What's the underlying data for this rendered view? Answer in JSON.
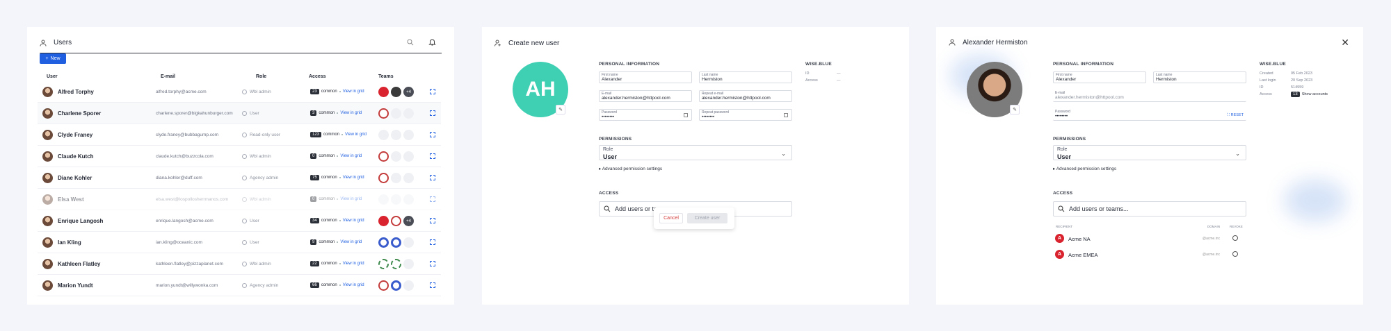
{
  "users_panel": {
    "title": "Users",
    "new_button": "New",
    "columns": [
      "User",
      "E-mail",
      "Role",
      "Access",
      "Teams"
    ],
    "common_label": "common",
    "view_label": "View in grid",
    "rows": [
      {
        "name": "Alfred Torphy",
        "email": "alfred.torphy@acme.com",
        "role": "Wbl admin",
        "count": "23",
        "teams": [
          "red",
          "dark",
          "plus"
        ],
        "plus": "+4"
      },
      {
        "name": "Charlene Sporer",
        "email": "charlene.sporer@bigkahunburger.com",
        "role": "User",
        "count": "3",
        "teams": [
          "logo",
          "empty",
          "empty"
        ]
      },
      {
        "name": "Clyde Franey",
        "email": "clyde.franey@bubbagump.com",
        "role": "Read-only user",
        "count": "123",
        "teams": [
          "empty",
          "empty",
          "empty"
        ]
      },
      {
        "name": "Claude Kutch",
        "email": "claude.kutch@buzzcola.com",
        "role": "Wbl admin",
        "count": "0",
        "teams": [
          "logo",
          "empty",
          "empty"
        ]
      },
      {
        "name": "Diane Kohler",
        "email": "diana.kohler@duff.com",
        "role": "Agency admin",
        "count": "75",
        "teams": [
          "logo",
          "empty",
          "empty"
        ]
      },
      {
        "name": "Elsa West",
        "email": "elsa.west@lospollosherrmanos.com",
        "role": "Wbl admin",
        "count": "0",
        "teams": [
          "empty",
          "empty",
          "empty"
        ],
        "dim": true
      },
      {
        "name": "Enrique Langosh",
        "email": "enrique.langosh@acme.com",
        "role": "User",
        "count": "34",
        "teams": [
          "red",
          "logo",
          "plus"
        ],
        "plus": "+4"
      },
      {
        "name": "Ian Kling",
        "email": "ian.kling@oceanic.com",
        "role": "User",
        "count": "9",
        "teams": [
          "blue",
          "blue",
          "empty"
        ]
      },
      {
        "name": "Kathleen Flatley",
        "email": "kathleen.flatley@pizzaplanet.com",
        "role": "Wbl admin",
        "count": "22",
        "teams": [
          "grn",
          "grn",
          "empty"
        ]
      },
      {
        "name": "Marion Yundt",
        "email": "marion.yundt@willywonka.com",
        "role": "Agency admin",
        "count": "66",
        "teams": [
          "logo",
          "blue",
          "empty"
        ]
      }
    ]
  },
  "create_panel": {
    "title": "Create new user",
    "initials": "AH",
    "personal_info": "PERSONAL INFORMATION",
    "first_name_label": "First name",
    "first_name": "Alexander",
    "last_name_label": "Last name",
    "last_name": "Hermiston",
    "email_label": "E-mail",
    "email": "alexander.hermiston@httpool.com",
    "repeat_email_label": "Repeat e-mail",
    "repeat_email": "alexander.hermiston@httpool.com",
    "password_label": "Password",
    "password": "••••••••",
    "repeat_password_label": "Repeat password",
    "repeat_password": "••••••••",
    "wise_title": "WISE.BLUE",
    "id_label": "ID",
    "id_value": "—",
    "access_label": "Access",
    "access_value": "—",
    "permissions": "PERMISSIONS",
    "role_label": "Role",
    "role_value": "User",
    "advanced": "Advanced permission settings",
    "access_title": "ACCESS",
    "search_placeholder": "Add users or teams...",
    "cancel": "Cancel",
    "create": "Create user"
  },
  "detail_panel": {
    "title": "Alexander Hermiston",
    "personal_info": "PERSONAL INFORMATION",
    "first_name_label": "First name",
    "first_name": "Alexander",
    "last_name_label": "Last name",
    "last_name": "Hermiston",
    "email_label": "E-mail",
    "email": "alexander.hermiston@httpool.com",
    "password_label": "Password",
    "password": "••••••••",
    "reset": "RESET",
    "wise_title": "WISE.BLUE",
    "created_label": "Created",
    "created": "05 Feb 2023",
    "last_login_label": "Last login",
    "last_login": "20 Sep 2023",
    "id_label": "ID",
    "id_value": "514959",
    "access_label": "Access",
    "access_count": "13",
    "show_accounts": "Show accounts",
    "permissions": "PERMISSIONS",
    "role_label": "Role",
    "role_value": "User",
    "advanced": "Advanced permission settings",
    "access_title": "ACCESS",
    "search_placeholder": "Add users or teams...",
    "recipient_col": "RECIPIENT",
    "domain_col": "DOMAIN",
    "revoke_col": "REVOKE",
    "recipients": [
      {
        "name": "Acme NA",
        "domain": "@acme.inc"
      },
      {
        "name": "Acme EMEA",
        "domain": "@acme.inc"
      }
    ]
  },
  "colors": {
    "accent": "#1f5fe0",
    "teal_avatar": "#3fd0b4",
    "cancel_red": "#d43a3a"
  }
}
